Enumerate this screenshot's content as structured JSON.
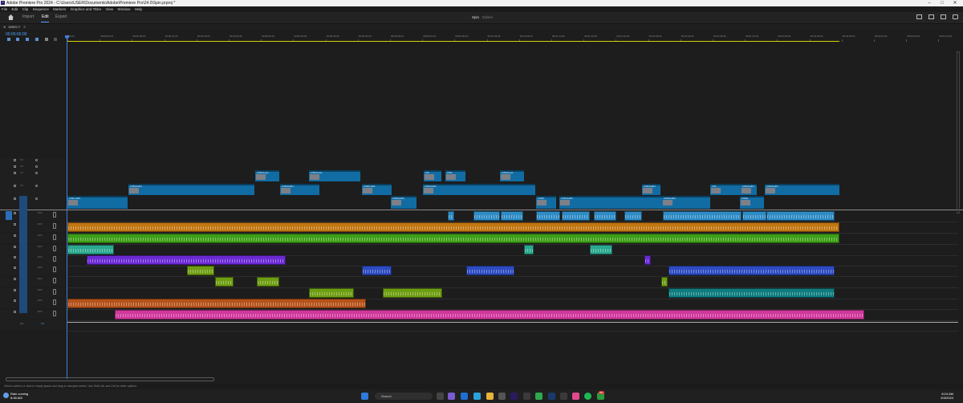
{
  "window": {
    "title": "Adobe Premiere Pro 2024 - C:\\Users\\USER\\Documents\\Adobe\\Premiere Pro\\24.0\\Spin.prproj *",
    "app_badge": "Pr",
    "controls": [
      "–",
      "□",
      "✕"
    ]
  },
  "menu": [
    "File",
    "Edit",
    "Clip",
    "Sequence",
    "Markers",
    "Graphics and Titles",
    "View",
    "Window",
    "Help"
  ],
  "header": {
    "tabs": [
      "Import",
      "Edit",
      "Export"
    ],
    "active_tab": "Edit",
    "project_name": "Spin",
    "project_suffix": "Edited"
  },
  "sequence": {
    "tab_label": "DIRECT",
    "timecode": "00:00:00:00"
  },
  "ruler": {
    "labels": [
      "00:00",
      "00:00:04:23",
      "00:00:09:23",
      "00:00:14:23",
      "00:00:19:23",
      "00:00:24:23",
      "00:00:29:23",
      "00:00:34:23",
      "00:00:39:23",
      "00:00:44:23",
      "00:00:49:23",
      "00:00:54:23",
      "00:00:59:22",
      "00:01:04:22",
      "00:01:09:22",
      "00:01:14:22",
      "00:01:19:22",
      "00:01:24:22",
      "00:01:29:22",
      "00:01:34:22",
      "00:01:39:22",
      "00:01:44:22",
      "00:01:49:22",
      "00:01:54:22",
      "00:01:59:21",
      "00:02:04:21",
      "00:02:09:21",
      "00:02:14:21",
      "00:02:19:21"
    ]
  },
  "tracks": {
    "video": [
      "V6",
      "V5",
      "V4",
      "V3",
      "V2",
      "V1"
    ],
    "audio": [
      "A1",
      "A2",
      "A3",
      "A4",
      "A5",
      "A6",
      "A7",
      "A8",
      "A9",
      "A10",
      "A11"
    ],
    "mix_label": "Mix",
    "mix_value": "0.0"
  },
  "video_clips": [
    {
      "track": "V4",
      "name": "CHSCN.mp4"
    },
    {
      "track": "V4",
      "name": "CHSCN.mp4"
    },
    {
      "track": "V4",
      "name": "CHL"
    },
    {
      "track": "V4",
      "name": "CHSL"
    },
    {
      "track": "V4",
      "name": "CHSCN.mp4"
    },
    {
      "track": "V3",
      "name": "CHSCN.MP4"
    },
    {
      "track": "V3",
      "name": "CHSCN.MP4"
    },
    {
      "track": "V3",
      "name": "CHSOL.MP4"
    },
    {
      "track": "V3",
      "name": "CHSCN.MP4"
    },
    {
      "track": "V3",
      "name": "CHSCN.MP4"
    },
    {
      "track": "V3",
      "name": "CHS"
    },
    {
      "track": "V3",
      "name": "CHSCN.MP4"
    },
    {
      "track": "V3",
      "name": "CHSCN.MP4"
    },
    {
      "track": "V2",
      "name": "CHSL7.MP4"
    },
    {
      "track": "V2",
      "name": "CHSCN.MP4"
    },
    {
      "track": "V2",
      "name": "CHSOL"
    },
    {
      "track": "V2",
      "name": "CHSCN.MP4"
    },
    {
      "track": "V2",
      "name": "CHSCN.MP4"
    },
    {
      "track": "V2",
      "name": "CHSOL"
    }
  ],
  "colors": {
    "video_clip": "#116ca3",
    "a1": "#2f8bc4",
    "a2": "#c17610",
    "a3": "#3d9e17",
    "a4": "#2aa88f",
    "a5": "#6b2ad3",
    "a6": "#2d4bc2",
    "a7": "#6e9e12",
    "a8": "#0f7d7f",
    "a9": "#b5531a",
    "a10": "#d0389c",
    "workbar": "#d7d200",
    "playhead": "#3f7fd8"
  },
  "status": "Click to select, or click in empty space and drag to marquee select. Use Shift, Alt, and Ctrl for other options.",
  "taskbar": {
    "weather_line1": "Rain coming",
    "weather_line2": "8:48 AM",
    "search": "Search",
    "time": "8:24 AM",
    "date": "8/3/2024",
    "notification_count": "99+"
  }
}
